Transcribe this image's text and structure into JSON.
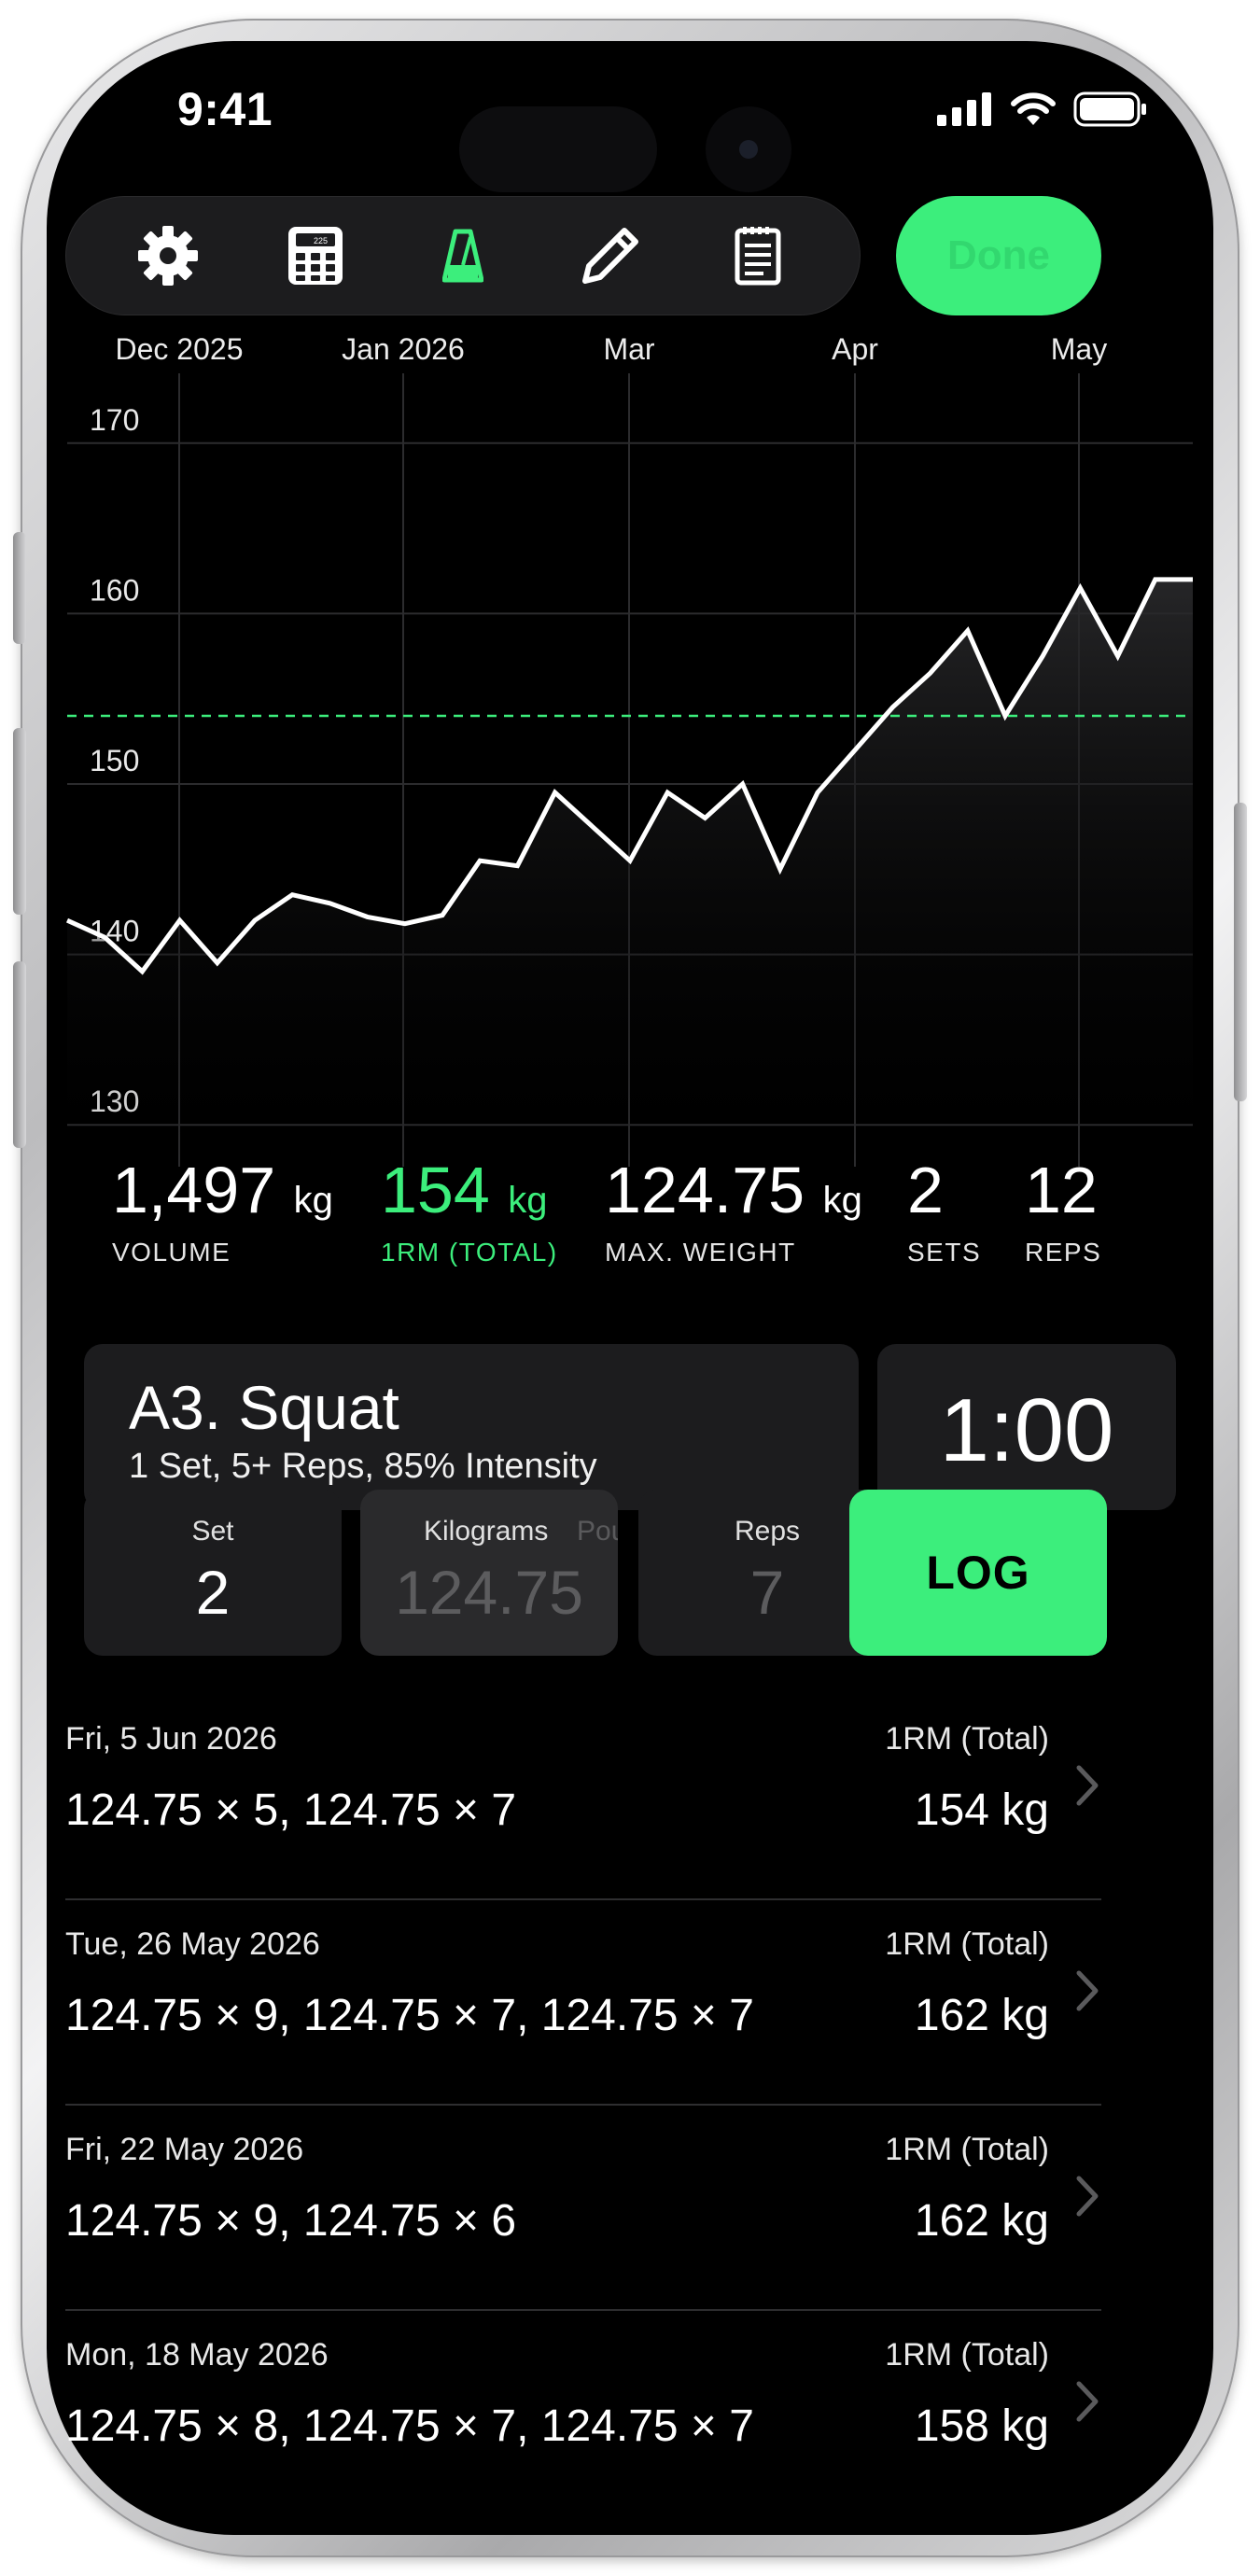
{
  "status": {
    "time": "9:41"
  },
  "toolbar": {
    "done_label": "Done",
    "icons": [
      "gear-icon",
      "plate-calculator-icon",
      "metronome-icon",
      "pencil-icon",
      "notes-icon"
    ]
  },
  "chart_data": {
    "type": "line",
    "x_labels": [
      "Dec 2025",
      "Jan 2026",
      "Mar",
      "Apr",
      "May"
    ],
    "y_ticks": [
      170,
      160,
      150,
      140,
      130
    ],
    "ylim": [
      127,
      173
    ],
    "reference_line": 154,
    "grid": true,
    "values": [
      142,
      141,
      139,
      142,
      139.5,
      142,
      143.5,
      143,
      142.2,
      141.8,
      142.3,
      145.5,
      145.2,
      149.5,
      147.5,
      145.5,
      149.5,
      148,
      150,
      145,
      149.5,
      152,
      154.5,
      156.5,
      159,
      154,
      157.5,
      161.5,
      157.5,
      162,
      162
    ]
  },
  "stats": [
    {
      "value": "1,497",
      "unit": "kg",
      "label": "VOLUME"
    },
    {
      "value": "154",
      "unit": "kg",
      "label": "1RM (TOTAL)"
    },
    {
      "value": "124.75",
      "unit": "kg",
      "label": "MAX. WEIGHT"
    },
    {
      "value": "2",
      "unit": "",
      "label": "SETS"
    },
    {
      "value": "12",
      "unit": "",
      "label": "REPS"
    }
  ],
  "exercise": {
    "title": "A3. Squat",
    "subtitle": "1 Set, 5+ Reps, 85% Intensity",
    "timer": "1:00"
  },
  "inputs": {
    "set_label": "Set",
    "set_value": "2",
    "kg_label": "Kilograms",
    "kg_value": "124.75",
    "pounds_label": "Pounds",
    "reps_label": "Reps",
    "reps_value": "7",
    "log_label": "LOG"
  },
  "colors": {
    "accent": "#3cee7c",
    "card": "#1c1c1e",
    "background": "#000000"
  },
  "history": [
    {
      "date": "Fri, 5 Jun 2026",
      "sets": "124.75 × 5, 124.75 × 7",
      "rm_label": "1RM (Total)",
      "rm": "154 kg"
    },
    {
      "date": "Tue, 26 May 2026",
      "sets": "124.75 × 9, 124.75 × 7, 124.75 × 7",
      "rm_label": "1RM (Total)",
      "rm": "162 kg"
    },
    {
      "date": "Fri, 22 May 2026",
      "sets": "124.75 × 9, 124.75 × 6",
      "rm_label": "1RM (Total)",
      "rm": "162 kg"
    },
    {
      "date": "Mon, 18 May 2026",
      "sets": "124.75 × 8, 124.75 × 7, 124.75 × 7",
      "rm_label": "1RM (Total)",
      "rm": "158 kg"
    }
  ]
}
